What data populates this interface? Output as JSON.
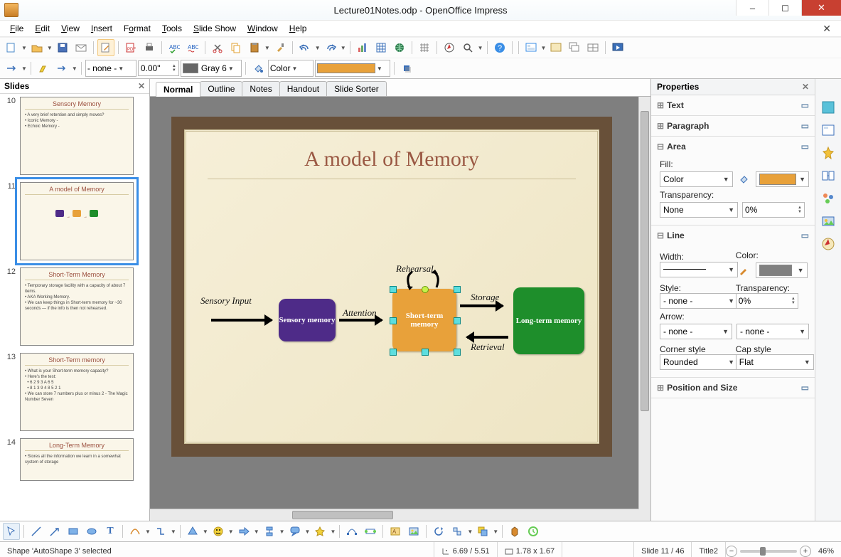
{
  "title": "Lecture01Notes.odp - OpenOffice Impress",
  "menu": [
    "File",
    "Edit",
    "View",
    "Insert",
    "Format",
    "Tools",
    "Slide Show",
    "Window",
    "Help"
  ],
  "tb_line": {
    "style_select": "- none -"
  },
  "tb_width": "0.00\"",
  "tb_color_name": "Gray 6",
  "tb_fill_label": "Color",
  "slides_panel_title": "Slides",
  "thumbs": [
    {
      "num": "10",
      "title": "Sensory Memory"
    },
    {
      "num": "11",
      "title": "A model of Memory"
    },
    {
      "num": "12",
      "title": "Short-Term Memory"
    },
    {
      "num": "13",
      "title": "Short-Term memory"
    },
    {
      "num": "14",
      "title": "Long-Term Memory"
    }
  ],
  "view_tabs": [
    "Normal",
    "Outline",
    "Notes",
    "Handout",
    "Slide Sorter"
  ],
  "slide": {
    "title": "A model of Memory",
    "labels": {
      "sensory_input": "Sensory Input",
      "attention": "Attention",
      "rehearsal": "Rehearsal",
      "storage": "Storage",
      "retrieval": "Retrieval"
    },
    "boxes": {
      "sensory": "Sensory memory",
      "shortterm": "Short-term memory",
      "longterm": "Long-term memory"
    }
  },
  "props": {
    "title": "Properties",
    "sections": {
      "text": "Text",
      "paragraph": "Paragraph",
      "area": "Area",
      "line": "Line",
      "pos_size": "Position and Size"
    },
    "area": {
      "fill_label": "Fill:",
      "fill_type": "Color",
      "transparency_label": "Transparency:",
      "transparency_type": "None",
      "transparency_value": "0%"
    },
    "line": {
      "width_label": "Width:",
      "color_label": "Color:",
      "style_label": "Style:",
      "style_value": "- none -",
      "transparency_label": "Transparency:",
      "transparency_value": "0%",
      "arrow_label": "Arrow:",
      "arrow_start": "- none -",
      "arrow_end": "- none -",
      "corner_label": "Corner style",
      "corner_value": "Rounded",
      "cap_label": "Cap style",
      "cap_value": "Flat"
    }
  },
  "status": {
    "selection": "Shape 'AutoShape 3' selected",
    "pos": "6.69 / 5.51",
    "size": "1.78 x 1.67",
    "slide_num": "Slide 11 / 46",
    "master": "Title2",
    "zoom": "46%"
  }
}
